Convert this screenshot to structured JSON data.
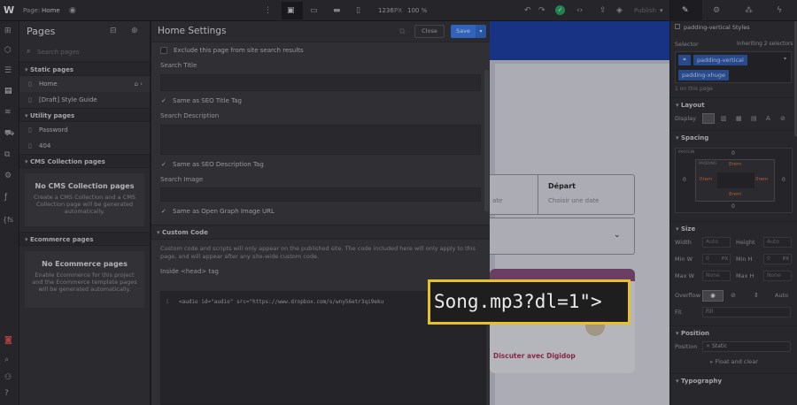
{
  "topbar": {
    "page_label": "Page:",
    "page_name": "Home",
    "width": "1236",
    "width_unit": "PX",
    "zoom": "100 %",
    "publish": "Publish"
  },
  "pages_panel": {
    "title": "Pages",
    "search_placeholder": "Search pages",
    "static_header": "Static pages",
    "static_items": [
      "Home",
      "[Draft] Style Guide"
    ],
    "utility_header": "Utility pages",
    "utility_items": [
      "Password",
      "404"
    ],
    "cms_header": "CMS Collection pages",
    "cms_title": "No CMS Collection pages",
    "cms_desc": "Create a CMS Collection and a CMS Collection page will be generated automatically.",
    "ecom_header": "Ecommerce pages",
    "ecom_title": "No Ecommerce pages",
    "ecom_desc": "Enable Ecommerce for this project and the Ecommerce template pages will be generated automatically."
  },
  "settings": {
    "title": "Home Settings",
    "close": "Close",
    "save": "Save",
    "exclude": "Exclude this page from site search results",
    "search_title": "Search Title",
    "same_seo_title": "Same as SEO Title Tag",
    "search_description": "Search Description",
    "same_seo_desc": "Same as SEO Description Tag",
    "search_image": "Search Image",
    "same_og": "Same as Open Graph Image URL",
    "custom_code_header": "Custom Code",
    "custom_code_desc": "Custom code and scripts will only appear on the published site. The code included here will only apply to this page, and will appear after any site-wide custom code.",
    "head_tag_label": "Inside <head> tag",
    "line_number": "1",
    "code_line": "<audio id=\"audio\" src=\"https://www.dropbox.com/s/wny56etr3qi9eku"
  },
  "canvas": {
    "cell_left": "ate",
    "depart": "Départ",
    "choose_date": "Choisir une date",
    "chat": "Discuter avec Digidop"
  },
  "overlay_text": "Song.mp3?dl=1\">",
  "right_panel": {
    "selector_heading": "padding-vertical Styles",
    "selector_label": "Selector",
    "inheriting": "Inheriting 2 selectors",
    "class1": "padding-vertical",
    "class2": "padding-xhuge",
    "on_page": "1 on this page",
    "layout": "Layout",
    "display": "Display",
    "spacing": "Spacing",
    "margin": "MARGIN",
    "padding": "PADDING",
    "margin_val": "0",
    "padding_top": "8rem",
    "padding_side": "0rem",
    "size": "Size",
    "width": "Width",
    "height": "Height",
    "auto": "Auto",
    "minw": "Min W",
    "minh": "Min H",
    "maxw": "Max W",
    "maxh": "Max H",
    "px": "PX",
    "none": "None",
    "overflow": "Overflow",
    "fit": "Fit",
    "fill": "Fill",
    "position": "Position",
    "static": "Static",
    "float": "Float and clear",
    "typography": "Typography"
  },
  "colors": {
    "accent": "#3b82f6",
    "highlight": "#e8c028"
  }
}
